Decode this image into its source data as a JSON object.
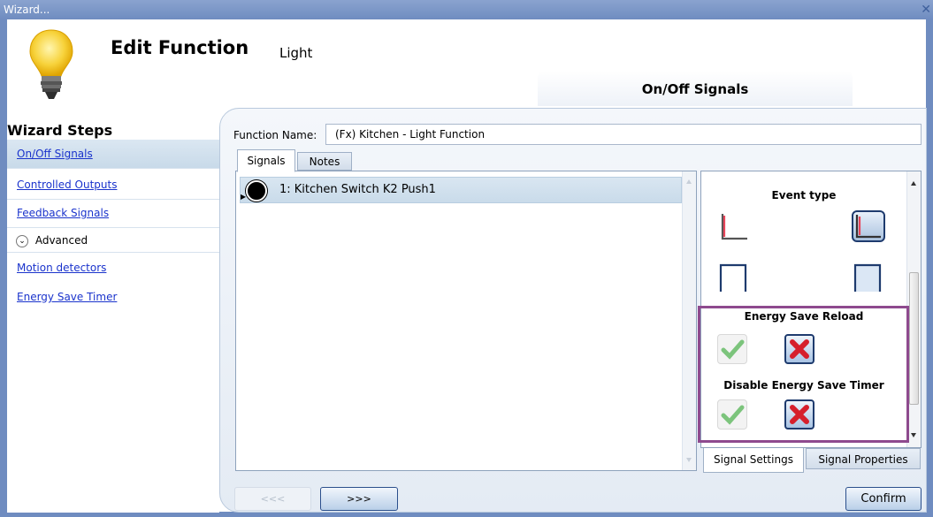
{
  "window": {
    "title": "Wizard...",
    "close_glyph": "✕"
  },
  "header": {
    "title": "Edit Function",
    "subtitle": "Light",
    "step_tab": "On/Off Signals",
    "icon": "light-bulb-icon"
  },
  "sidebar": {
    "heading": "Wizard Steps",
    "items": [
      {
        "label": "On/Off Signals"
      },
      {
        "label": "Controlled Outputs"
      },
      {
        "label": "Feedback Signals"
      }
    ],
    "advanced": {
      "label": "Advanced",
      "glyph": "⌄"
    },
    "advanced_items": [
      {
        "label": "Motion detectors"
      },
      {
        "label": "Energy Save Timer"
      }
    ]
  },
  "form": {
    "function_name_label": "Function Name:",
    "function_name_value": "(Fx) Kitchen - Light Function"
  },
  "tabs": {
    "signals": "Signals",
    "notes": "Notes"
  },
  "signal_list": [
    {
      "label": "1: Kitchen Switch K2 Push1"
    }
  ],
  "settings": {
    "event_type": "Event type",
    "energy_save_reload": "Energy Save Reload",
    "disable_energy_save_timer": "Disable Energy Save Timer",
    "tabs": {
      "signal_settings": "Signal Settings",
      "signal_properties": "Signal Properties"
    }
  },
  "footer": {
    "prev": "<<<",
    "next": ">>>",
    "confirm": "Confirm"
  },
  "colors": {
    "accent": "#6f8cc0",
    "highlight_border": "#8e4a8e",
    "link": "#1a33cc"
  }
}
